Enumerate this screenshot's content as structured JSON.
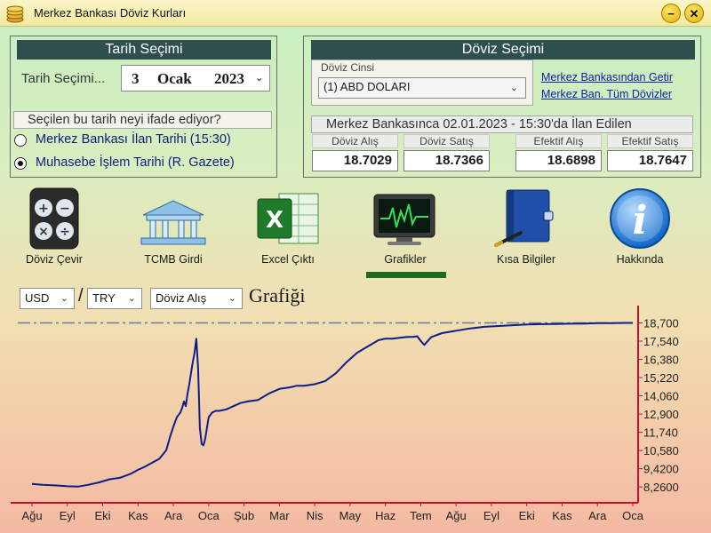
{
  "window": {
    "title": "Merkez Bankası Döviz Kurları",
    "minimize_label": "−",
    "close_label": "✕"
  },
  "date_panel": {
    "header": "Tarih Seçimi",
    "date_label": "Tarih Seçimi...",
    "day": "3",
    "month": "Ocak",
    "year": "2023",
    "question": "Seçilen bu tarih neyi ifade ediyor?",
    "options": [
      {
        "label": "Merkez Bankası İlan Tarihi (15:30)",
        "selected": false
      },
      {
        "label": "Muhasebe İşlem Tarihi (R. Gazete)",
        "selected": true
      }
    ]
  },
  "currency_panel": {
    "header": "Döviz Seçimi",
    "currency_label": "Döviz Cinsi",
    "currency_value": "(1) ABD DOLARI",
    "link_fetch": "Merkez Bankasından Getir",
    "link_all": "Merkez Ban. Tüm Dövizler",
    "announcement": "Merkez Bankasınca 02.01.2023 - 15:30'da İlan Edilen",
    "rates": [
      {
        "label": "Döviz Alış",
        "value": "18.7029"
      },
      {
        "label": "Döviz Satış",
        "value": "18.7366"
      },
      {
        "label": "Efektif Alış",
        "value": "18.6898"
      },
      {
        "label": "Efektif Satış",
        "value": "18.7647"
      }
    ]
  },
  "toolbar": {
    "items": [
      {
        "label": "Döviz Çevir",
        "icon": "calculator-icon"
      },
      {
        "label": "TCMB Girdi",
        "icon": "bank-building-icon"
      },
      {
        "label": "Excel Çıktı",
        "icon": "excel-icon"
      },
      {
        "label": "Grafikler",
        "icon": "monitor-chart-icon",
        "active": true
      },
      {
        "label": "Kısa Bilgiler",
        "icon": "book-icon"
      },
      {
        "label": "Hakkında",
        "icon": "info-icon"
      }
    ],
    "active_color": "#1f6b1f"
  },
  "chart_controls": {
    "from_currency": "USD",
    "separator": "/",
    "to_currency": "TRY",
    "rate_type": "Döviz Alış",
    "title_suffix": "Grafiği"
  },
  "chart_data": {
    "type": "line",
    "x_labels": [
      "Ağu",
      "Eyl",
      "Eki",
      "Kas",
      "Ara",
      "Oca",
      "Şub",
      "Mar",
      "Nis",
      "May",
      "Haz",
      "Tem",
      "Ağu",
      "Eyl",
      "Eki",
      "Kas",
      "Ara",
      "Oca"
    ],
    "y_ticks": [
      "18,700",
      "17,540",
      "16,380",
      "15,220",
      "14,060",
      "12,900",
      "11,740",
      "10,580",
      "9,4200",
      "8,2600"
    ],
    "y_tick_values": [
      18.7,
      17.54,
      16.38,
      15.22,
      14.06,
      12.9,
      11.74,
      10.58,
      9.42,
      8.26
    ],
    "ylim": [
      7.25,
      19.35
    ],
    "reference_line": 18.7,
    "line_color": "#0c1e8c",
    "axis_color": "#c8102e",
    "series": [
      {
        "x": [
          0,
          0.3,
          0.7,
          1.0,
          1.3,
          1.6,
          1.9,
          2.2,
          2.5,
          2.8,
          3.0,
          3.2,
          3.4,
          3.6,
          3.8,
          3.9,
          4.0,
          4.1,
          4.2,
          4.25,
          4.3,
          4.35,
          4.4,
          4.45,
          4.5,
          4.55,
          4.6,
          4.65,
          4.7,
          4.75,
          4.8,
          4.85,
          4.9,
          5.0,
          5.1,
          5.2,
          5.3,
          5.5,
          5.7,
          5.9,
          6.1,
          6.4,
          6.7,
          7.0,
          7.3,
          7.5,
          7.7,
          8.0,
          8.3,
          8.6,
          8.9,
          9.2,
          9.5,
          9.8,
          10.0,
          10.2,
          10.4,
          10.6,
          10.8,
          10.9,
          11.0,
          11.1,
          11.3,
          11.6,
          12.0,
          12.4,
          12.8,
          13.2,
          13.6,
          14.0,
          14.4,
          14.8,
          15.2,
          15.6,
          16.0,
          16.4,
          16.8,
          17.0
        ],
        "y": [
          8.45,
          8.4,
          8.35,
          8.3,
          8.28,
          8.4,
          8.55,
          8.75,
          8.85,
          9.1,
          9.35,
          9.55,
          9.8,
          10.05,
          10.6,
          11.4,
          12.1,
          12.7,
          13.0,
          13.3,
          13.7,
          13.4,
          14.2,
          14.8,
          15.5,
          16.2,
          16.8,
          17.7,
          15.8,
          12.0,
          11.0,
          10.9,
          11.3,
          12.7,
          13.0,
          13.1,
          13.1,
          13.2,
          13.4,
          13.6,
          13.7,
          13.8,
          14.2,
          14.5,
          14.6,
          14.7,
          14.7,
          14.8,
          15.0,
          15.5,
          16.2,
          16.8,
          17.2,
          17.6,
          17.7,
          17.7,
          17.75,
          17.8,
          17.82,
          17.85,
          17.55,
          17.3,
          17.8,
          18.05,
          18.2,
          18.35,
          18.45,
          18.5,
          18.55,
          18.6,
          18.62,
          18.63,
          18.65,
          18.66,
          18.68,
          18.69,
          18.7,
          18.7
        ]
      }
    ],
    "grid": false
  }
}
